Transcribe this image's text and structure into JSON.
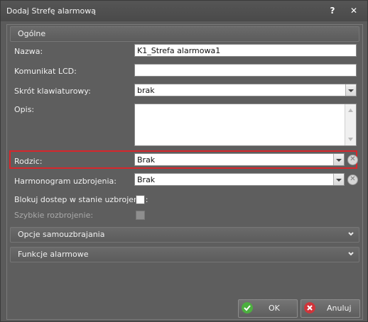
{
  "window": {
    "title": "Dodaj Strefę alarmową",
    "help_glyph": "?",
    "close_glyph": "✕"
  },
  "sections": {
    "general": "Ogólne",
    "auto_arm": "Opcje samouzbrajania",
    "alarm_functions": "Funkcje alarmowe"
  },
  "fields": {
    "name_label": "Nazwa:",
    "name_value": "K1_Strefa alarmowa1",
    "lcd_label": "Komunikat LCD:",
    "lcd_value": "",
    "shortcut_label": "Skrót klawiaturowy:",
    "shortcut_value": "brak",
    "description_label": "Opis:",
    "description_value": "",
    "parent_label": "Rodzic:",
    "parent_value": "Brak",
    "schedule_label": "Harmonogram uzbrojenia:",
    "schedule_value": "Brak",
    "block_access_label": "Blokuj dostep w stanie uzbrojenia:",
    "block_access_checked": false,
    "quick_arm_label": "Szybkie rozbrojenie:",
    "quick_arm_checked": false
  },
  "buttons": {
    "ok": "OK",
    "cancel": "Anuluj"
  },
  "colors": {
    "highlight": "#d8262b",
    "ok_icon": "#4caf3f",
    "cancel_icon": "#d0343a",
    "window_bg": "#5b5b5b"
  }
}
